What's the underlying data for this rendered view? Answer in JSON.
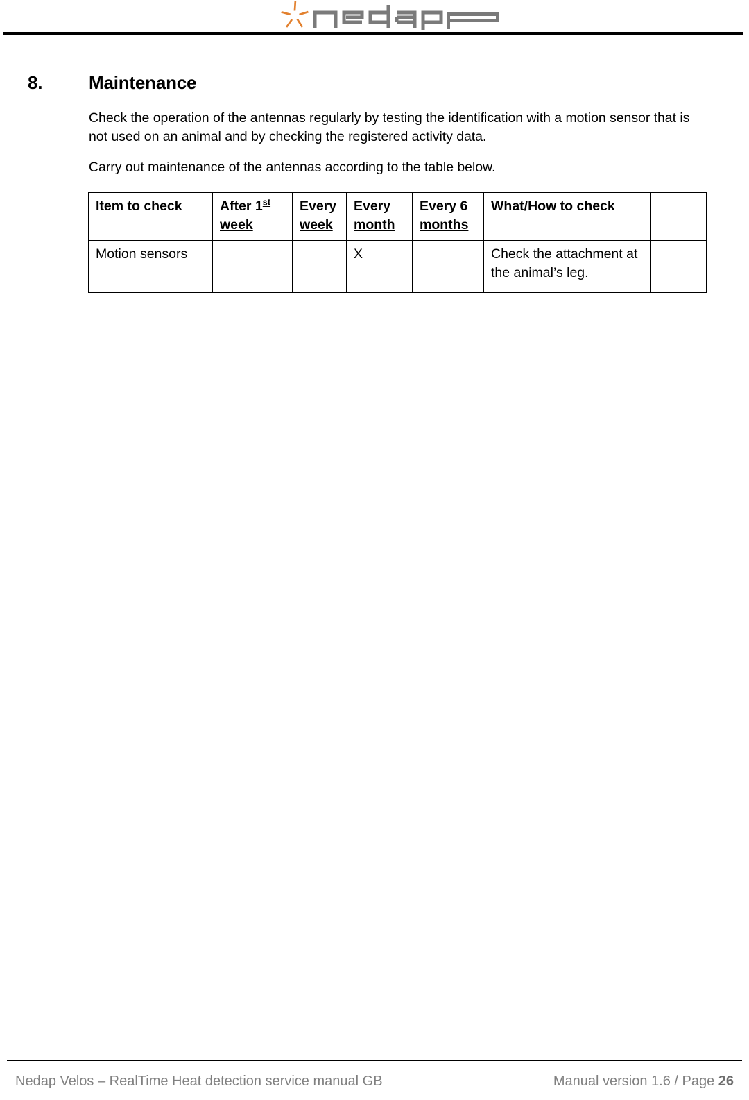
{
  "header": {
    "logo": {
      "name": "nedap-logo",
      "wordmark": "nedap",
      "star_color": "#E2802E",
      "wordmark_color": "#7A7A7A"
    }
  },
  "section": {
    "number": "8.",
    "title": "Maintenance"
  },
  "body": {
    "paragraph_1": "Check the operation of the antennas regularly by testing the identification with a motion sensor that is not used on an animal and by checking the registered activity data.",
    "paragraph_2": "Carry out maintenance of the antennas according to the table below."
  },
  "table": {
    "headers": [
      {
        "label": "Item to check",
        "underline": true
      },
      {
        "label": "After 1",
        "sup": "st",
        "label_2": "week",
        "underline": true
      },
      {
        "label": "Every",
        "label_2": "week",
        "underline": true
      },
      {
        "label": "Every",
        "label_2": "month",
        "underline": true
      },
      {
        "label": "Every 6",
        "label_2": "months",
        "underline": true
      },
      {
        "label": "What/How to check",
        "underline": true
      },
      {
        "label": "",
        "underline": false
      }
    ],
    "rows": [
      {
        "item": "Motion sensors",
        "after_1st_week": "",
        "every_week": "",
        "every_month": "X",
        "every_6_months": "",
        "what_how": "Check the attachment at the animal’s leg.",
        "extra": ""
      }
    ]
  },
  "footer": {
    "left": "Nedap Velos – RealTime Heat detection service manual GB",
    "right_prefix": "Manual version 1.6 / Page ",
    "page_number": "26"
  }
}
